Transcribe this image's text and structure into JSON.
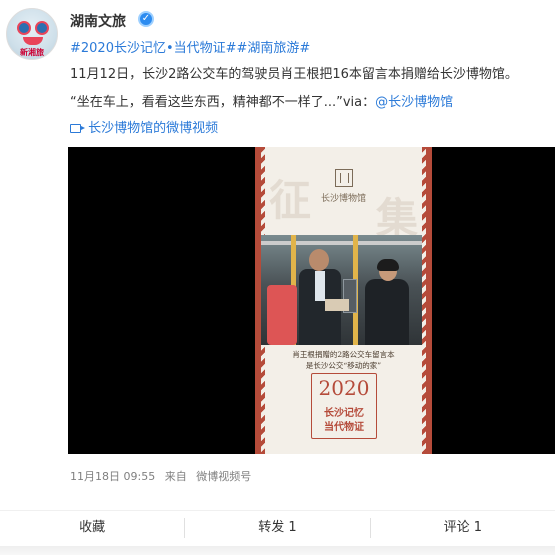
{
  "post": {
    "author_name": "湖南文旅",
    "avatar_tagline": "新湘旅",
    "topics": "#2020长沙记忆•当代物证##湖南旅游#",
    "text_line1": "11月12日，长沙2路公交车的驾驶员肖王根把16本留言本捐赠给长沙博物馆。",
    "text_line2_prefix": "“坐在车上，看看这些东西，精神都不一样了...”via：",
    "mention": "@长沙博物馆",
    "video_link": "长沙博物馆的微博视频",
    "timestamp": "11月18日 09:55",
    "source_label": "来自",
    "source": "微博视频号"
  },
  "video": {
    "museum_name": "长沙博物馆",
    "big_left": "征",
    "big_right": "集",
    "caption_line1": "肖王根捐赠的2路公交车留言本",
    "caption_line2": "是长沙公交“移动的家”",
    "badge_year": "2020",
    "badge_line1": "长沙记忆",
    "badge_line2": "当代物证"
  },
  "actions": {
    "favorite": "收藏",
    "repost": "转发 1",
    "comment": "评论 1"
  },
  "colors": {
    "link": "#2b7ad8",
    "poster_red": "#b54b3a",
    "verified": "#2d8cf0"
  },
  "icons": {
    "verified": "verified-badge-icon",
    "video": "video-camera-icon"
  }
}
